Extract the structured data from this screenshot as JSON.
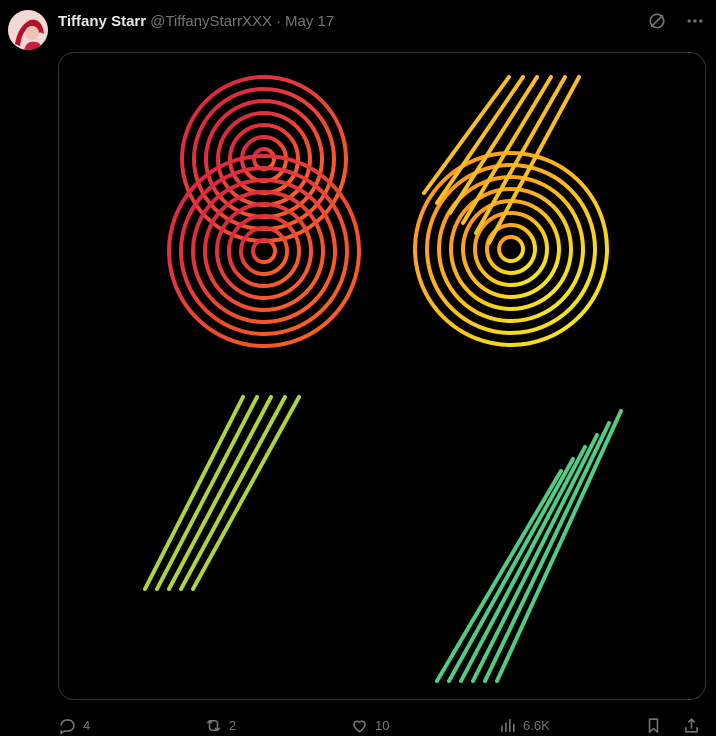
{
  "post": {
    "author_name": "Tiffany Starr",
    "author_handle": "@TiffanyStarrXXX",
    "separator": "·",
    "date": "May 17",
    "image_text": "8647"
  },
  "actions": {
    "replies": "4",
    "reposts": "2",
    "likes": "10",
    "views": "6.6K"
  },
  "icons": {
    "top": [
      "grok-icon",
      "more-icon"
    ],
    "actions": [
      "reply-icon",
      "repost-icon",
      "like-icon",
      "views-icon",
      "bookmark-icon",
      "share-icon"
    ]
  },
  "colors": {
    "background": "#000000",
    "text": "#e7e9ea",
    "muted": "#71767b",
    "border": "#2f3336"
  }
}
